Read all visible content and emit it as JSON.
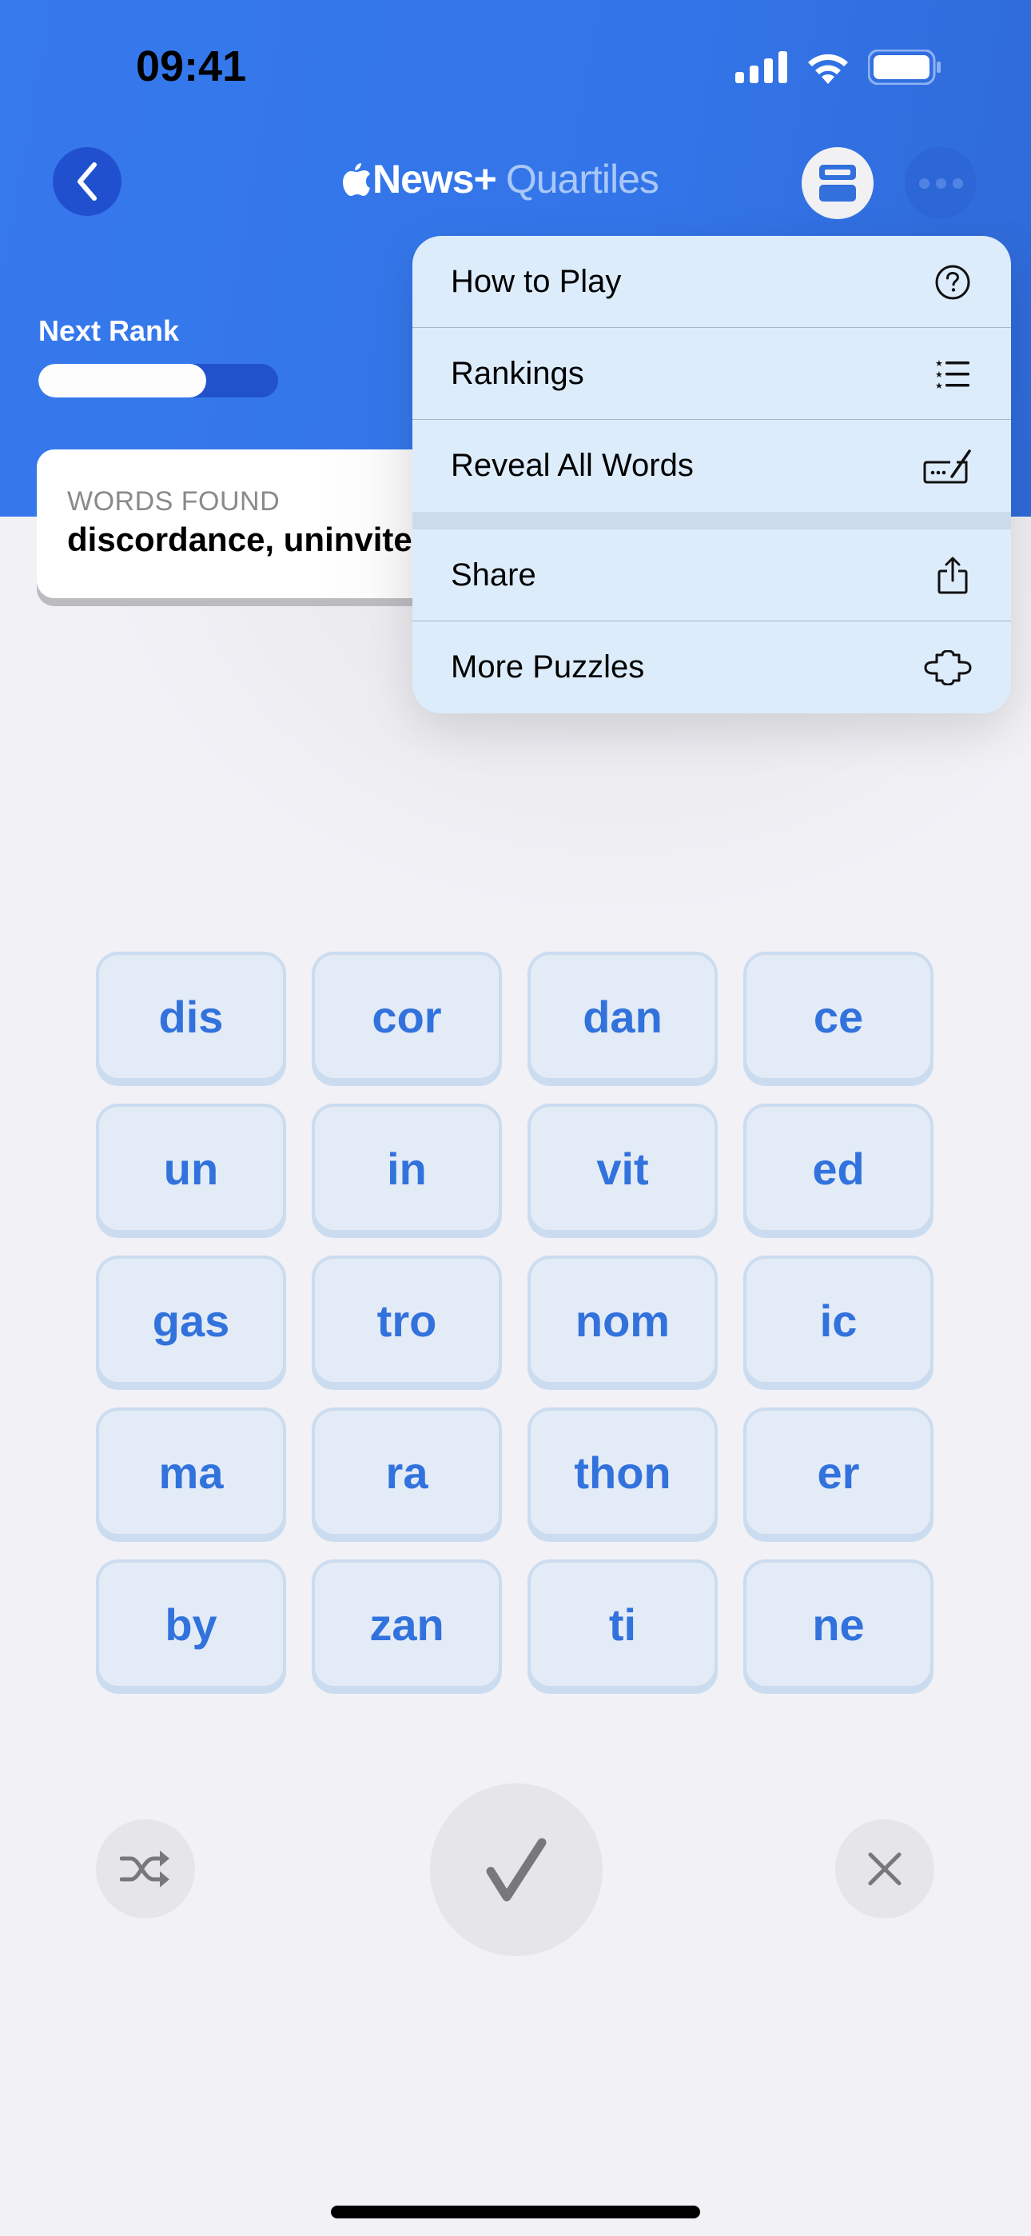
{
  "status_bar": {
    "time": "09:41",
    "icons": [
      "cellular-signal-icon",
      "wifi-icon",
      "battery-icon"
    ]
  },
  "nav": {
    "back_icon": "chevron-left-icon",
    "brand": "News+",
    "brand_icon": "apple-logo-icon",
    "game": "Quartiles",
    "layout_icon": "two-row-layout-icon",
    "more_icon": "ellipsis-icon"
  },
  "rank": {
    "label": "Next Rank",
    "progress_percent": 70
  },
  "words_found": {
    "label": "WORDS FOUND",
    "value": "discordance, uninvited"
  },
  "menu": {
    "groups": [
      [
        {
          "label": "How to Play",
          "icon": "question-circle-icon"
        },
        {
          "label": "Rankings",
          "icon": "star-list-icon"
        },
        {
          "label": "Reveal All Words",
          "icon": "reveal-pencil-icon"
        }
      ],
      [
        {
          "label": "Share",
          "icon": "share-icon"
        },
        {
          "label": "More Puzzles",
          "icon": "puzzle-piece-icon"
        }
      ]
    ]
  },
  "tiles": [
    [
      "dis",
      "cor",
      "dan",
      "ce"
    ],
    [
      "un",
      "in",
      "vit",
      "ed"
    ],
    [
      "gas",
      "tro",
      "nom",
      "ic"
    ],
    [
      "ma",
      "ra",
      "thon",
      "er"
    ],
    [
      "by",
      "zan",
      "ti",
      "ne"
    ]
  ],
  "controls": {
    "shuffle_icon": "shuffle-icon",
    "submit_icon": "checkmark-icon",
    "clear_icon": "close-icon"
  },
  "colors": {
    "header_blue": "#3679ed",
    "tile_text": "#3272dd",
    "tile_bg": "#e3ebf6",
    "menu_bg": "#ddecfb"
  }
}
